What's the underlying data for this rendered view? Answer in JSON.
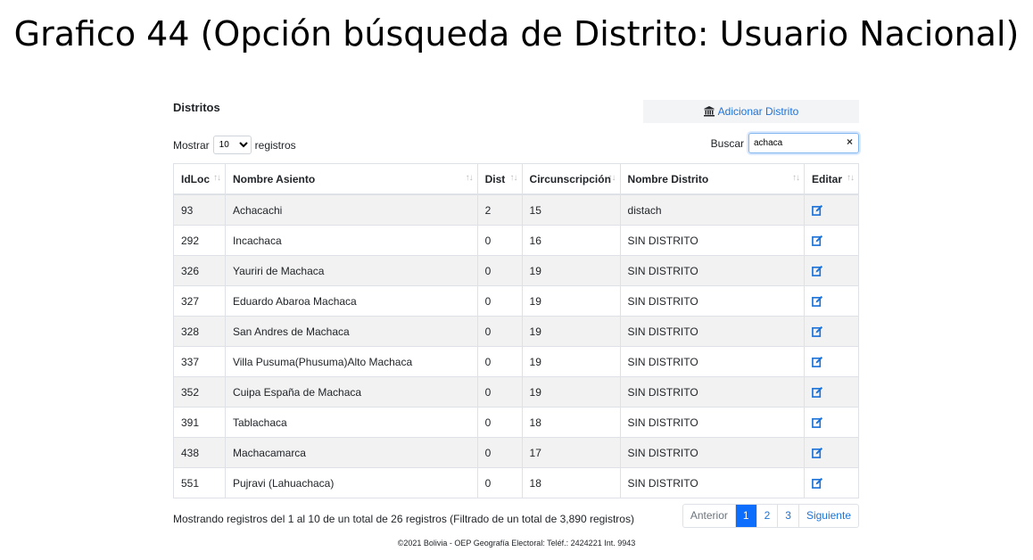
{
  "slide_title": "Grafico 44 (Opción búsqueda de Distrito: Usuario Nacional)",
  "panel": {
    "title": "Distritos",
    "add_button_label": "Adicionar Distrito"
  },
  "length_control": {
    "prefix": "Mostrar",
    "selected": "10",
    "suffix": "registros"
  },
  "search": {
    "label": "Buscar",
    "value": "achaca"
  },
  "table": {
    "headers": [
      "IdLoc",
      "Nombre Asiento",
      "Dist",
      "Circunscripción",
      "Nombre Distrito",
      "Editar"
    ],
    "rows": [
      {
        "idloc": "93",
        "nombre": "Achacachi",
        "dist": "2",
        "circ": "15",
        "distrito": "distach"
      },
      {
        "idloc": "292",
        "nombre": "Incachaca",
        "dist": "0",
        "circ": "16",
        "distrito": "SIN DISTRITO"
      },
      {
        "idloc": "326",
        "nombre": "Yauriri de Machaca",
        "dist": "0",
        "circ": "19",
        "distrito": "SIN DISTRITO"
      },
      {
        "idloc": "327",
        "nombre": "Eduardo Abaroa Machaca",
        "dist": "0",
        "circ": "19",
        "distrito": "SIN DISTRITO"
      },
      {
        "idloc": "328",
        "nombre": "San Andres de Machaca",
        "dist": "0",
        "circ": "19",
        "distrito": "SIN DISTRITO"
      },
      {
        "idloc": "337",
        "nombre": "Villa Pusuma(Phusuma)Alto Machaca",
        "dist": "0",
        "circ": "19",
        "distrito": "SIN DISTRITO"
      },
      {
        "idloc": "352",
        "nombre": "Cuipa España de Machaca",
        "dist": "0",
        "circ": "19",
        "distrito": "SIN DISTRITO"
      },
      {
        "idloc": "391",
        "nombre": "Tablachaca",
        "dist": "0",
        "circ": "18",
        "distrito": "SIN DISTRITO"
      },
      {
        "idloc": "438",
        "nombre": "Machacamarca",
        "dist": "0",
        "circ": "17",
        "distrito": "SIN DISTRITO"
      },
      {
        "idloc": "551",
        "nombre": "Pujravi (Lahuachaca)",
        "dist": "0",
        "circ": "18",
        "distrito": "SIN DISTRITO"
      }
    ]
  },
  "info_text": "Mostrando registros del 1 al 10 de un total de 26 registros (Filtrado de un total de 3,890 registros)",
  "pagination": {
    "previous": "Anterior",
    "pages": [
      "1",
      "2",
      "3"
    ],
    "active_page": "1",
    "next": "Siguiente"
  },
  "footer_text": "©2021 Bolivia - OEP Geografía Electoral: Teléf.: 2424221 Int. 9943",
  "colors": {
    "link": "#1e73d8",
    "active_page": "#0d6efd",
    "stripe": "#f2f2f2"
  },
  "icons": {
    "add_button": "institution-icon",
    "edit": "edit-icon",
    "clear": "close-icon"
  }
}
